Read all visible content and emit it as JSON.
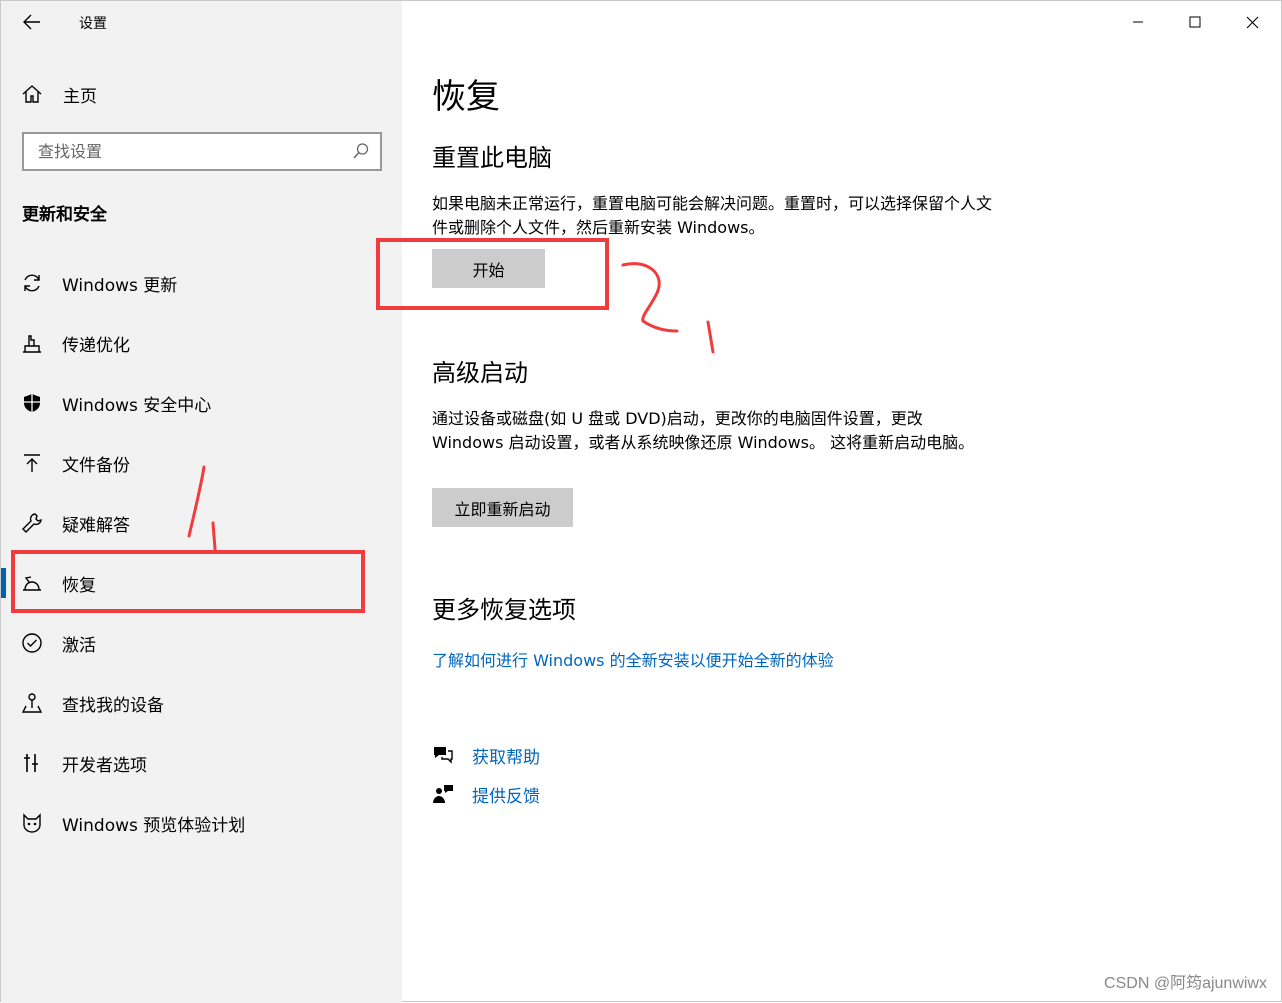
{
  "window": {
    "app_title": "设置",
    "controls": [
      "minimize",
      "maximize",
      "close"
    ]
  },
  "sidebar": {
    "home_label": "主页",
    "search_placeholder": "查找设置",
    "section_title": "更新和安全",
    "items": [
      {
        "label": "Windows 更新",
        "icon": "sync-icon"
      },
      {
        "label": "传递优化",
        "icon": "delivery-optimization-icon"
      },
      {
        "label": "Windows 安全中心",
        "icon": "shield-icon"
      },
      {
        "label": "文件备份",
        "icon": "backup-arrow-icon"
      },
      {
        "label": "疑难解答",
        "icon": "wrench-icon"
      },
      {
        "label": "恢复",
        "icon": "recovery-icon",
        "active": true
      },
      {
        "label": "激活",
        "icon": "check-circle-icon"
      },
      {
        "label": "查找我的设备",
        "icon": "find-device-icon"
      },
      {
        "label": "开发者选项",
        "icon": "developer-tools-icon"
      },
      {
        "label": "Windows 预览体验计划",
        "icon": "insider-cat-icon"
      }
    ]
  },
  "main": {
    "title": "恢复",
    "reset": {
      "heading": "重置此电脑",
      "description": "如果电脑未正常运行，重置电脑可能会解决问题。重置时，可以选择保留个人文件或删除个人文件，然后重新安装 Windows。",
      "button": "开始"
    },
    "advanced": {
      "heading": "高级启动",
      "description": "通过设备或磁盘(如 U 盘或 DVD)启动，更改你的电脑固件设置，更改 Windows 启动设置，或者从系统映像还原 Windows。 这将重新启动电脑。",
      "button": "立即重新启动"
    },
    "more": {
      "heading": "更多恢复选项",
      "link": "了解如何进行 Windows 的全新安装以便开始全新的体验"
    },
    "help": {
      "get_help": "获取帮助",
      "feedback": "提供反馈"
    }
  },
  "annotations": {
    "color": "#f03c3c",
    "marks": [
      "1",
      "2"
    ]
  },
  "watermark": "CSDN @阿筠ajunwiwx",
  "colors": {
    "sidebar_bg": "#f2f2f2",
    "accent": "#0063b1",
    "link": "#0067c0",
    "button_bg": "#cccccc"
  }
}
